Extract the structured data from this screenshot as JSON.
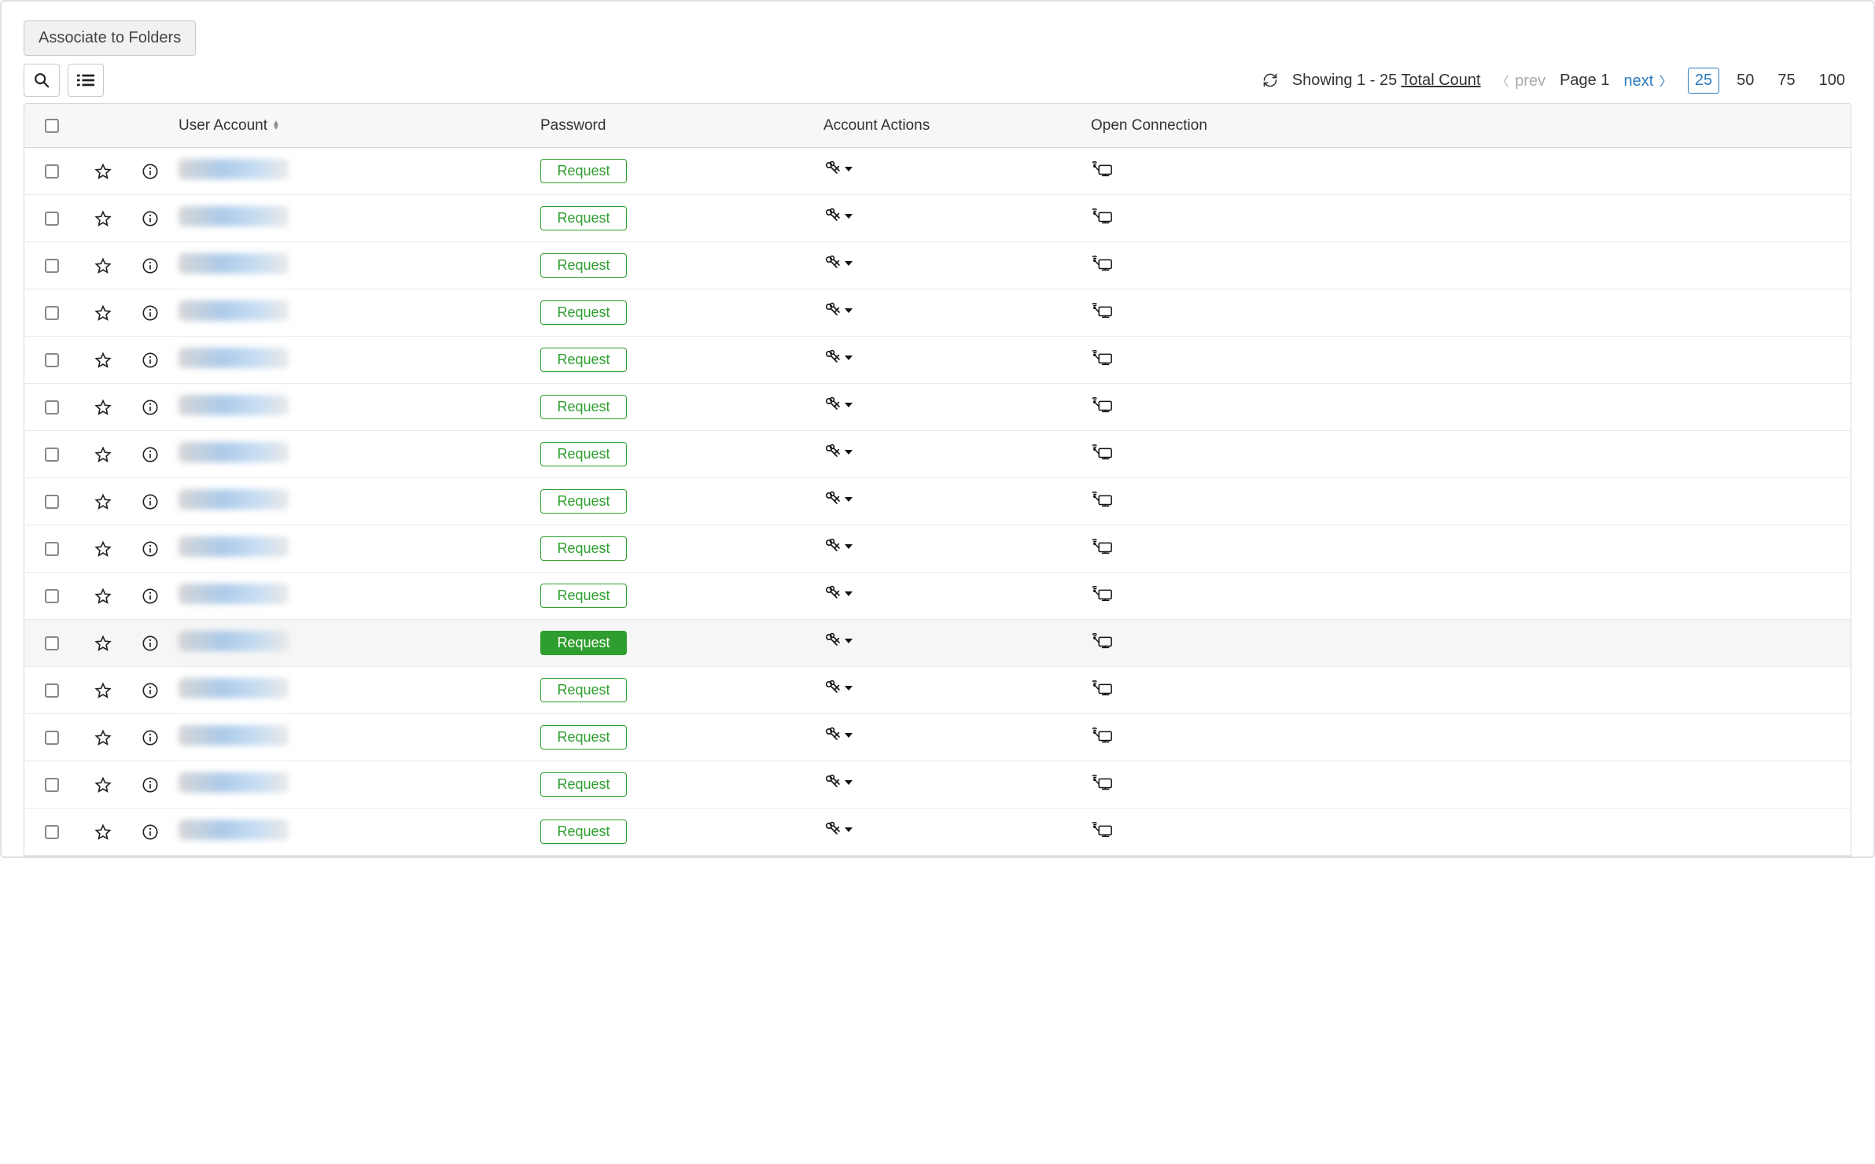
{
  "toolbar": {
    "associate_label": "Associate to Folders"
  },
  "pager": {
    "showing_prefix": "Showing",
    "range": "1 - 25",
    "total_label": "Total Count",
    "prev_label": "prev",
    "page_label": "Page 1",
    "next_label": "next",
    "sizes": [
      "25",
      "50",
      "75",
      "100"
    ],
    "active_size": "25"
  },
  "columns": {
    "user_account": "User Account",
    "password": "Password",
    "account_actions": "Account Actions",
    "open_connection": "Open Connection"
  },
  "request_label": "Request",
  "rows": [
    {
      "hover": false
    },
    {
      "hover": false
    },
    {
      "hover": false
    },
    {
      "hover": false
    },
    {
      "hover": false
    },
    {
      "hover": false
    },
    {
      "hover": false
    },
    {
      "hover": false
    },
    {
      "hover": false
    },
    {
      "hover": false
    },
    {
      "hover": true
    },
    {
      "hover": false
    },
    {
      "hover": false
    },
    {
      "hover": false
    },
    {
      "hover": false
    }
  ]
}
